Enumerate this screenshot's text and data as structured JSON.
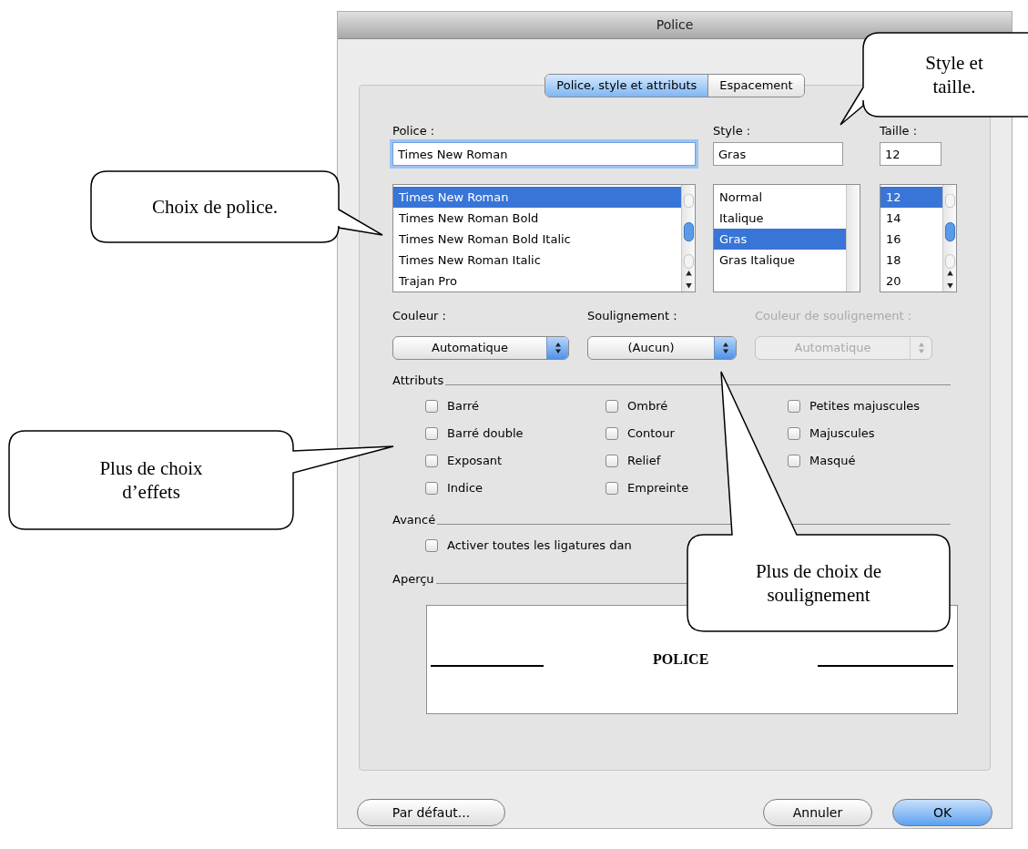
{
  "window": {
    "title": "Police"
  },
  "tabs": [
    {
      "label": "Police, style et attributs",
      "selected": true
    },
    {
      "label": "Espacement",
      "selected": false
    }
  ],
  "font": {
    "label": "Police :",
    "value": "Times New Roman",
    "items": [
      {
        "label": "Times New Roman",
        "selected": true
      },
      {
        "label": "Times New Roman Bold",
        "selected": false
      },
      {
        "label": "Times New Roman Bold Italic",
        "selected": false
      },
      {
        "label": "Times New Roman Italic",
        "selected": false
      },
      {
        "label": "Trajan Pro",
        "selected": false
      }
    ]
  },
  "style": {
    "label": "Style :",
    "value": "Gras",
    "items": [
      {
        "label": "Normal",
        "selected": false
      },
      {
        "label": "Italique",
        "selected": false
      },
      {
        "label": "Gras",
        "selected": true
      },
      {
        "label": "Gras Italique",
        "selected": false
      }
    ]
  },
  "size": {
    "label": "Taille :",
    "value": "12",
    "items": [
      {
        "label": "12",
        "selected": true
      },
      {
        "label": "14",
        "selected": false
      },
      {
        "label": "16",
        "selected": false
      },
      {
        "label": "18",
        "selected": false
      },
      {
        "label": "20",
        "selected": false
      }
    ]
  },
  "popups": [
    {
      "label": "Couleur :",
      "value": "Automatique",
      "disabled": false
    },
    {
      "label": "Soulignement :",
      "value": "(Aucun)",
      "disabled": false
    },
    {
      "label": "Couleur de soulignement :",
      "value": "Automatique",
      "disabled": true
    }
  ],
  "attributes": {
    "title": "Attributs",
    "columns": [
      [
        {
          "label": "Barré",
          "checked": false
        },
        {
          "label": "Barré double",
          "checked": false
        },
        {
          "label": "Exposant",
          "checked": false
        },
        {
          "label": "Indice",
          "checked": false
        }
      ],
      [
        {
          "label": "Ombré",
          "checked": false
        },
        {
          "label": "Contour",
          "checked": false
        },
        {
          "label": "Relief",
          "checked": false
        },
        {
          "label": "Empreinte",
          "checked": false
        }
      ],
      [
        {
          "label": "Petites majuscules",
          "checked": false
        },
        {
          "label": "Majuscules",
          "checked": false
        },
        {
          "label": "Masqué",
          "checked": false
        }
      ]
    ]
  },
  "advanced": {
    "title": "Avancé",
    "options": [
      {
        "label": "Activer toutes les ligatures dan",
        "checked": false
      }
    ]
  },
  "preview": {
    "title": "Aperçu",
    "text": "POLICE"
  },
  "buttons": [
    {
      "label": "Par défaut...",
      "default": false
    },
    {
      "label": "Annuler",
      "default": false
    },
    {
      "label": "OK",
      "default": true
    }
  ],
  "callouts": [
    {
      "text": "Style et taille."
    },
    {
      "text": "Choix de police."
    },
    {
      "text": "Plus de choix d’effets"
    },
    {
      "text": "Plus de choix de soulignement"
    }
  ]
}
